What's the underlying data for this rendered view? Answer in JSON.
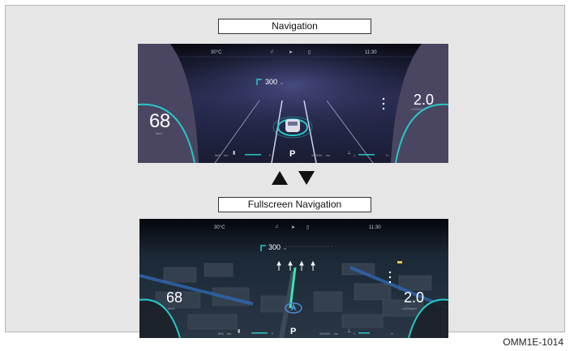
{
  "top_label": "Navigation",
  "bottom_label": "Fullscreen Navigation",
  "figure_code": "OMM1E-1014",
  "cluster": {
    "temperature": "30°C",
    "clock": "11:30",
    "turn_distance": "300",
    "turn_distance_unit": "m",
    "speed": "68",
    "speed_unit": "km/h",
    "rpm": "2.0",
    "rpm_unit": "x1000rpm",
    "range": "666",
    "range_unit": "km",
    "fuel_full": "F",
    "gear": "P",
    "odometer": "980000",
    "odometer_unit": "km",
    "temp_cold": "C",
    "temp_hot": "H",
    "status_icons": [
      "music-icon",
      "navigation-arrow-icon",
      "phone-icon"
    ]
  },
  "transition_arrows": [
    "up-arrow-icon",
    "down-arrow-icon"
  ],
  "colors": {
    "accent": "#27c7c7",
    "route": "#3fe0b0"
  }
}
